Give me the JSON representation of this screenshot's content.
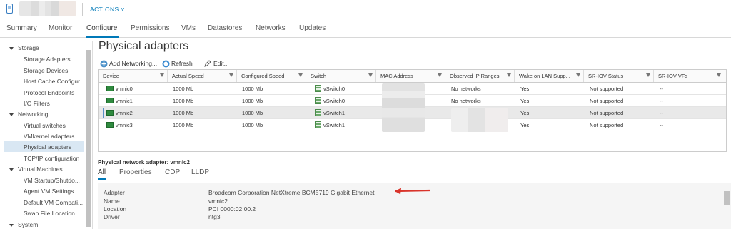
{
  "header": {
    "actions_label": "ACTIONS ˅"
  },
  "tabs": [
    {
      "label": "Summary"
    },
    {
      "label": "Monitor"
    },
    {
      "label": "Configure"
    },
    {
      "label": "Permissions"
    },
    {
      "label": "VMs"
    },
    {
      "label": "Datastores"
    },
    {
      "label": "Networks"
    },
    {
      "label": "Updates"
    }
  ],
  "nav": {
    "storage": "Storage",
    "storage_adapters": "Storage Adapters",
    "storage_devices": "Storage Devices",
    "host_cache": "Host Cache Configur...",
    "protocol_endpoints": "Protocol Endpoints",
    "io_filters": "I/O Filters",
    "networking": "Networking",
    "virtual_switches": "Virtual switches",
    "vmkernel_adapters": "VMkernel adapters",
    "physical_adapters": "Physical adapters",
    "tcpip": "TCP/IP configuration",
    "virtual_machines": "Virtual Machines",
    "vm_startup": "VM Startup/Shutdo...",
    "agent_vm": "Agent VM Settings",
    "default_vm": "Default VM Compati...",
    "swap_file": "Swap File Location",
    "system": "System"
  },
  "page_title": "Physical adapters",
  "toolbar": {
    "add_networking": "Add Networking...",
    "refresh": "Refresh",
    "edit": "Edit..."
  },
  "table": {
    "columns": [
      "Device",
      "Actual Speed",
      "Configured Speed",
      "Switch",
      "MAC Address",
      "Observed IP Ranges",
      "Wake on LAN Supp...",
      "SR-IOV Status",
      "SR-IOV VFs"
    ],
    "rows": [
      {
        "device": "vmnic0",
        "actual": "1000 Mb",
        "configured": "1000 Mb",
        "switch": "vSwitch0",
        "ip": "No networks",
        "wol": "Yes",
        "sriov": "Not supported",
        "vfs": "--"
      },
      {
        "device": "vmnic1",
        "actual": "1000 Mb",
        "configured": "1000 Mb",
        "switch": "vSwitch0",
        "ip": "No networks",
        "wol": "Yes",
        "sriov": "Not supported",
        "vfs": "--"
      },
      {
        "device": "vmnic2",
        "actual": "1000 Mb",
        "configured": "1000 Mb",
        "switch": "vSwitch1",
        "ip": "",
        "wol": "Yes",
        "sriov": "Not supported",
        "vfs": "--"
      },
      {
        "device": "vmnic3",
        "actual": "1000 Mb",
        "configured": "1000 Mb",
        "switch": "vSwitch1",
        "ip": "",
        "wol": "Yes",
        "sriov": "Not supported",
        "vfs": "--"
      }
    ]
  },
  "details": {
    "title": "Physical network adapter: vmnic2",
    "tabs": [
      "All",
      "Properties",
      "CDP",
      "LLDP"
    ],
    "fields": [
      {
        "label": "Adapter",
        "value": "Broadcom Corporation NetXtreme BCM5719 Gigabit Ethernet"
      },
      {
        "label": "Name",
        "value": "vmnic2"
      },
      {
        "label": "Location",
        "value": "PCI 0000:02:00.2"
      },
      {
        "label": "Driver",
        "value": "ntg3"
      }
    ]
  },
  "colors": {
    "accent": "#0079b8",
    "annotation_arrow": "#d9342b",
    "selected_row": "#e9e9e9"
  }
}
